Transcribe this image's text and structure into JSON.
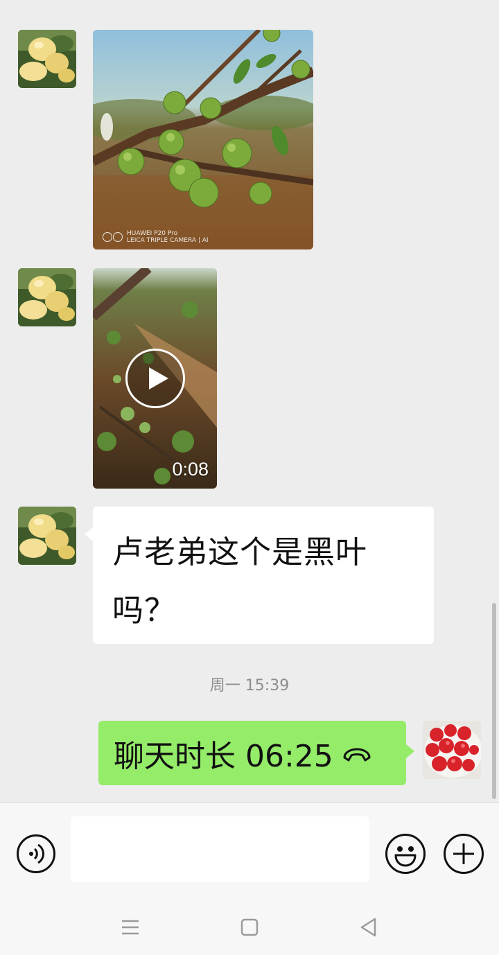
{
  "messages": {
    "photo": {
      "watermark_line1": "HUAWEI P20 Pro",
      "watermark_line2": "LEICA TRIPLE CAMERA | AI"
    },
    "video": {
      "duration": "0:08"
    },
    "text_in": {
      "text": "卢老弟这个是黑叶吗？"
    },
    "timestamp": "周一 15:39",
    "call_out": {
      "text": "聊天时长 06:25",
      "icon": "phone-hangup-icon"
    }
  },
  "input_bar": {
    "voice_icon": "voice-icon",
    "input_value": "",
    "emoji_icon": "emoji-icon",
    "plus_icon": "plus-icon"
  },
  "nav_bar": {
    "menu_icon": "menu-icon",
    "home_icon": "home-icon",
    "back_icon": "back-icon"
  },
  "colors": {
    "background": "#ededed",
    "bubble_in": "#ffffff",
    "bubble_out": "#95ec69",
    "input_bar": "#f7f7f7"
  }
}
